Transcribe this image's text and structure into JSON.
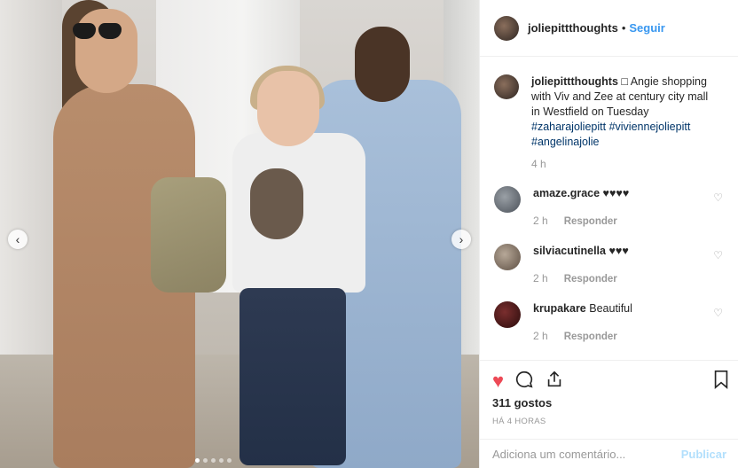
{
  "header": {
    "username": "joliepittthoughts",
    "separator": "•",
    "follow_label": "Seguir"
  },
  "caption": {
    "username": "joliepittthoughts",
    "text": " □ Angie shopping with Viv and Zee at century city mall in Westfield on Tuesday ",
    "hashtags": [
      "#zaharajoliepitt",
      "#viviennejoliepitt",
      "#angelinajolie"
    ],
    "time": "4 h"
  },
  "comments": [
    {
      "username": "amaze.grace",
      "text": "♥♥♥♥",
      "time": "2 h",
      "reply": "Responder"
    },
    {
      "username": "silviacutinella",
      "text": "♥♥♥",
      "time": "2 h",
      "reply": "Responder"
    },
    {
      "username": "krupakare",
      "text": "Beautiful",
      "time": "2 h",
      "reply": "Responder"
    }
  ],
  "actions": {
    "likes": "311 gostos",
    "posted_ago": "HÁ 4 HORAS",
    "comment_placeholder": "Adiciona um comentário...",
    "publish_label": "Publicar"
  },
  "icons": [
    "heart-icon",
    "comment-icon",
    "share-icon",
    "bookmark-icon",
    "chevron-left-icon",
    "chevron-right-icon"
  ],
  "colors": {
    "link": "#3897f0",
    "hashtag": "#003569",
    "like": "#ed4956",
    "muted": "#999999"
  }
}
